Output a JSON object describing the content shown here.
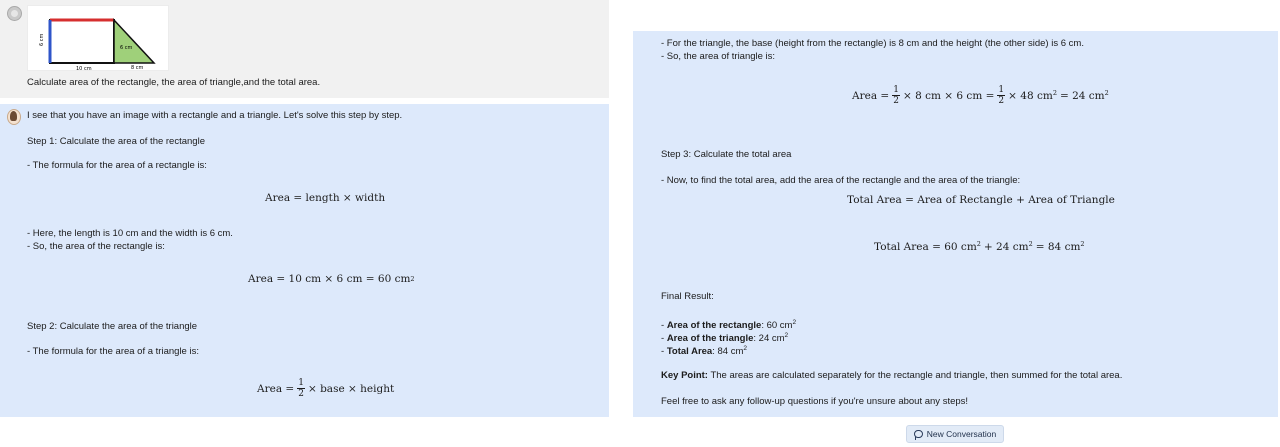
{
  "user": {
    "prompt": "Calculate area of the rectangle, the area of triangle,and the total area.",
    "figure": {
      "rect_side": "6 cm",
      "rect_bottom": "10 cm",
      "tri_side": "6 cm",
      "tri_bottom": "8 cm"
    }
  },
  "left": {
    "intro": "I see that you have an image with a rectangle and a triangle. Let's solve this step by step.",
    "step1": "Step 1: Calculate the area of the rectangle",
    "formula_rect_intro": "- The formula for the area of a rectangle is:",
    "formula_rect": "Area = length × width",
    "here_line": "- Here, the length is 10 cm and the width is 6 cm.",
    "so_rect": "- So, the area of the rectangle is:",
    "rect_calc_left": "Area = 10 cm × 6 cm = 60 cm",
    "step2": "Step 2: Calculate the area of the triangle",
    "formula_tri_intro": "- The formula for the area of a triangle is:",
    "tri_formula_lhs": "Area =",
    "half_num": "1",
    "half_den": "2",
    "tri_formula_rhs": "× base × height"
  },
  "right": {
    "tri_line1": "- For the triangle, the base (height from the rectangle) is 8 cm and the height (the other side) is 6 cm.",
    "tri_line2": "- So, the area of triangle is:",
    "tri_calc_lhs": "Area =",
    "tri_calc_mid": "× 8 cm × 6 cm =",
    "tri_calc_end": "× 48 cm",
    "tri_calc_result": "= 24 cm",
    "step3": "Step 3: Calculate the total area",
    "total_intro": "- Now, to find the total area, add the area of the rectangle and the area of the triangle:",
    "total_formula": "Total Area = Area of Rectangle + Area of Triangle",
    "total_calc": "Total Area = 60 cm",
    "total_calc_mid": "+ 24 cm",
    "total_calc_end": "= 84 cm",
    "final_result": "Final Result:",
    "res_rect_label": "Area of the rectangle",
    "res_rect_value": ": 60 cm",
    "res_tri_label": "Area of the triangle",
    "res_tri_value": ": 24 cm",
    "res_total_label": "Total Area",
    "res_total_value": ": 84 cm",
    "key_point_label": "Key Point:",
    "key_point_text": " The areas are calculated separately for the rectangle and triangle, then summed for the total area.",
    "follow_up": "Feel free to ask any follow-up questions if you're unsure about any steps!"
  },
  "new_conversation": "New Conversation",
  "sup2": "2"
}
